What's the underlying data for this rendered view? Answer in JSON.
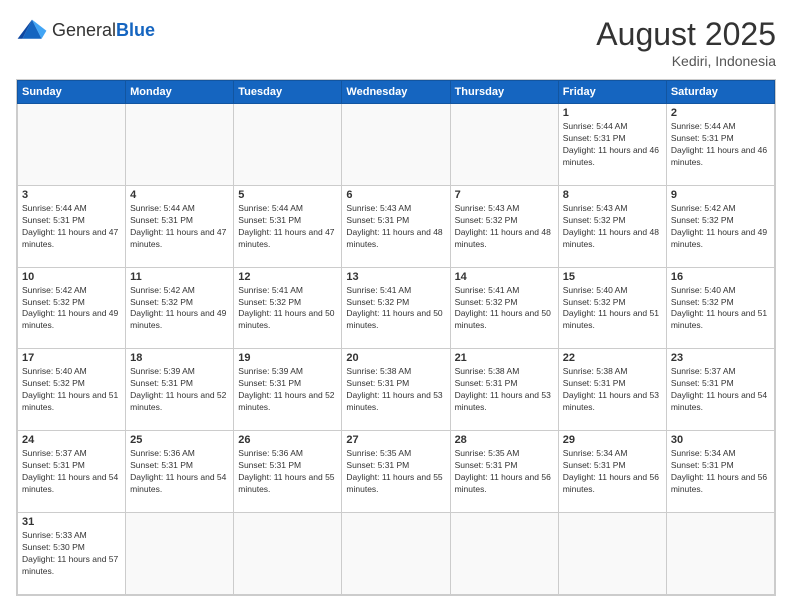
{
  "logo": {
    "text_general": "General",
    "text_blue": "Blue"
  },
  "header": {
    "month_year": "August 2025",
    "location": "Kediri, Indonesia"
  },
  "weekdays": [
    "Sunday",
    "Monday",
    "Tuesday",
    "Wednesday",
    "Thursday",
    "Friday",
    "Saturday"
  ],
  "weeks": [
    {
      "days": [
        {
          "num": "",
          "info": "",
          "empty": true
        },
        {
          "num": "",
          "info": "",
          "empty": true
        },
        {
          "num": "",
          "info": "",
          "empty": true
        },
        {
          "num": "",
          "info": "",
          "empty": true
        },
        {
          "num": "",
          "info": "",
          "empty": true
        },
        {
          "num": "1",
          "info": "Sunrise: 5:44 AM\nSunset: 5:31 PM\nDaylight: 11 hours and 46 minutes."
        },
        {
          "num": "2",
          "info": "Sunrise: 5:44 AM\nSunset: 5:31 PM\nDaylight: 11 hours and 46 minutes."
        }
      ]
    },
    {
      "days": [
        {
          "num": "3",
          "info": "Sunrise: 5:44 AM\nSunset: 5:31 PM\nDaylight: 11 hours and 47 minutes."
        },
        {
          "num": "4",
          "info": "Sunrise: 5:44 AM\nSunset: 5:31 PM\nDaylight: 11 hours and 47 minutes."
        },
        {
          "num": "5",
          "info": "Sunrise: 5:44 AM\nSunset: 5:31 PM\nDaylight: 11 hours and 47 minutes."
        },
        {
          "num": "6",
          "info": "Sunrise: 5:43 AM\nSunset: 5:31 PM\nDaylight: 11 hours and 48 minutes."
        },
        {
          "num": "7",
          "info": "Sunrise: 5:43 AM\nSunset: 5:32 PM\nDaylight: 11 hours and 48 minutes."
        },
        {
          "num": "8",
          "info": "Sunrise: 5:43 AM\nSunset: 5:32 PM\nDaylight: 11 hours and 48 minutes."
        },
        {
          "num": "9",
          "info": "Sunrise: 5:42 AM\nSunset: 5:32 PM\nDaylight: 11 hours and 49 minutes."
        }
      ]
    },
    {
      "days": [
        {
          "num": "10",
          "info": "Sunrise: 5:42 AM\nSunset: 5:32 PM\nDaylight: 11 hours and 49 minutes."
        },
        {
          "num": "11",
          "info": "Sunrise: 5:42 AM\nSunset: 5:32 PM\nDaylight: 11 hours and 49 minutes."
        },
        {
          "num": "12",
          "info": "Sunrise: 5:41 AM\nSunset: 5:32 PM\nDaylight: 11 hours and 50 minutes."
        },
        {
          "num": "13",
          "info": "Sunrise: 5:41 AM\nSunset: 5:32 PM\nDaylight: 11 hours and 50 minutes."
        },
        {
          "num": "14",
          "info": "Sunrise: 5:41 AM\nSunset: 5:32 PM\nDaylight: 11 hours and 50 minutes."
        },
        {
          "num": "15",
          "info": "Sunrise: 5:40 AM\nSunset: 5:32 PM\nDaylight: 11 hours and 51 minutes."
        },
        {
          "num": "16",
          "info": "Sunrise: 5:40 AM\nSunset: 5:32 PM\nDaylight: 11 hours and 51 minutes."
        }
      ]
    },
    {
      "days": [
        {
          "num": "17",
          "info": "Sunrise: 5:40 AM\nSunset: 5:32 PM\nDaylight: 11 hours and 51 minutes."
        },
        {
          "num": "18",
          "info": "Sunrise: 5:39 AM\nSunset: 5:31 PM\nDaylight: 11 hours and 52 minutes."
        },
        {
          "num": "19",
          "info": "Sunrise: 5:39 AM\nSunset: 5:31 PM\nDaylight: 11 hours and 52 minutes."
        },
        {
          "num": "20",
          "info": "Sunrise: 5:38 AM\nSunset: 5:31 PM\nDaylight: 11 hours and 53 minutes."
        },
        {
          "num": "21",
          "info": "Sunrise: 5:38 AM\nSunset: 5:31 PM\nDaylight: 11 hours and 53 minutes."
        },
        {
          "num": "22",
          "info": "Sunrise: 5:38 AM\nSunset: 5:31 PM\nDaylight: 11 hours and 53 minutes."
        },
        {
          "num": "23",
          "info": "Sunrise: 5:37 AM\nSunset: 5:31 PM\nDaylight: 11 hours and 54 minutes."
        }
      ]
    },
    {
      "days": [
        {
          "num": "24",
          "info": "Sunrise: 5:37 AM\nSunset: 5:31 PM\nDaylight: 11 hours and 54 minutes."
        },
        {
          "num": "25",
          "info": "Sunrise: 5:36 AM\nSunset: 5:31 PM\nDaylight: 11 hours and 54 minutes."
        },
        {
          "num": "26",
          "info": "Sunrise: 5:36 AM\nSunset: 5:31 PM\nDaylight: 11 hours and 55 minutes."
        },
        {
          "num": "27",
          "info": "Sunrise: 5:35 AM\nSunset: 5:31 PM\nDaylight: 11 hours and 55 minutes."
        },
        {
          "num": "28",
          "info": "Sunrise: 5:35 AM\nSunset: 5:31 PM\nDaylight: 11 hours and 56 minutes."
        },
        {
          "num": "29",
          "info": "Sunrise: 5:34 AM\nSunset: 5:31 PM\nDaylight: 11 hours and 56 minutes."
        },
        {
          "num": "30",
          "info": "Sunrise: 5:34 AM\nSunset: 5:31 PM\nDaylight: 11 hours and 56 minutes."
        }
      ]
    },
    {
      "days": [
        {
          "num": "31",
          "info": "Sunrise: 5:33 AM\nSunset: 5:30 PM\nDaylight: 11 hours and 57 minutes."
        },
        {
          "num": "",
          "info": "",
          "empty": true
        },
        {
          "num": "",
          "info": "",
          "empty": true
        },
        {
          "num": "",
          "info": "",
          "empty": true
        },
        {
          "num": "",
          "info": "",
          "empty": true
        },
        {
          "num": "",
          "info": "",
          "empty": true
        },
        {
          "num": "",
          "info": "",
          "empty": true
        }
      ]
    }
  ]
}
